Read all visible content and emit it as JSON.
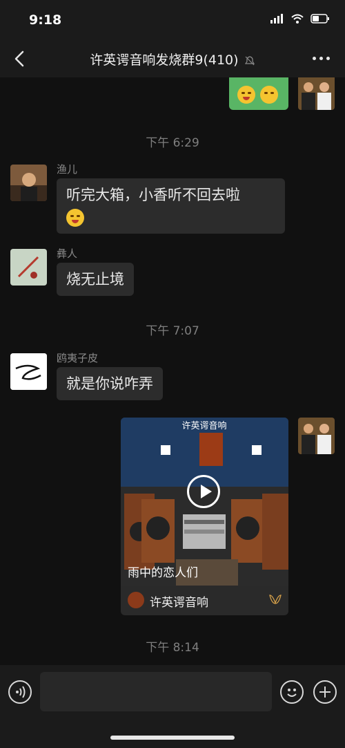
{
  "status": {
    "time": "9:18"
  },
  "nav": {
    "title": "许英谔音响发烧群9(410)"
  },
  "timestamps": [
    "下午 6:29",
    "下午 7:07",
    "下午 8:14"
  ],
  "messages": [
    {
      "sender": "渔儿",
      "text": "听完大箱，小香听不回去啦"
    },
    {
      "sender": "彝人",
      "text": "烧无止境"
    },
    {
      "sender": "鸥夷子皮",
      "text": "就是你说咋弄"
    }
  ],
  "video": {
    "caption": "雨中的恋人们",
    "channel": "许英谔音响",
    "sign_text": "许英谔音响"
  },
  "colors": {
    "background": "#111111",
    "bubble_incoming": "#2c2c2c",
    "bubble_outgoing": "#59b565"
  }
}
